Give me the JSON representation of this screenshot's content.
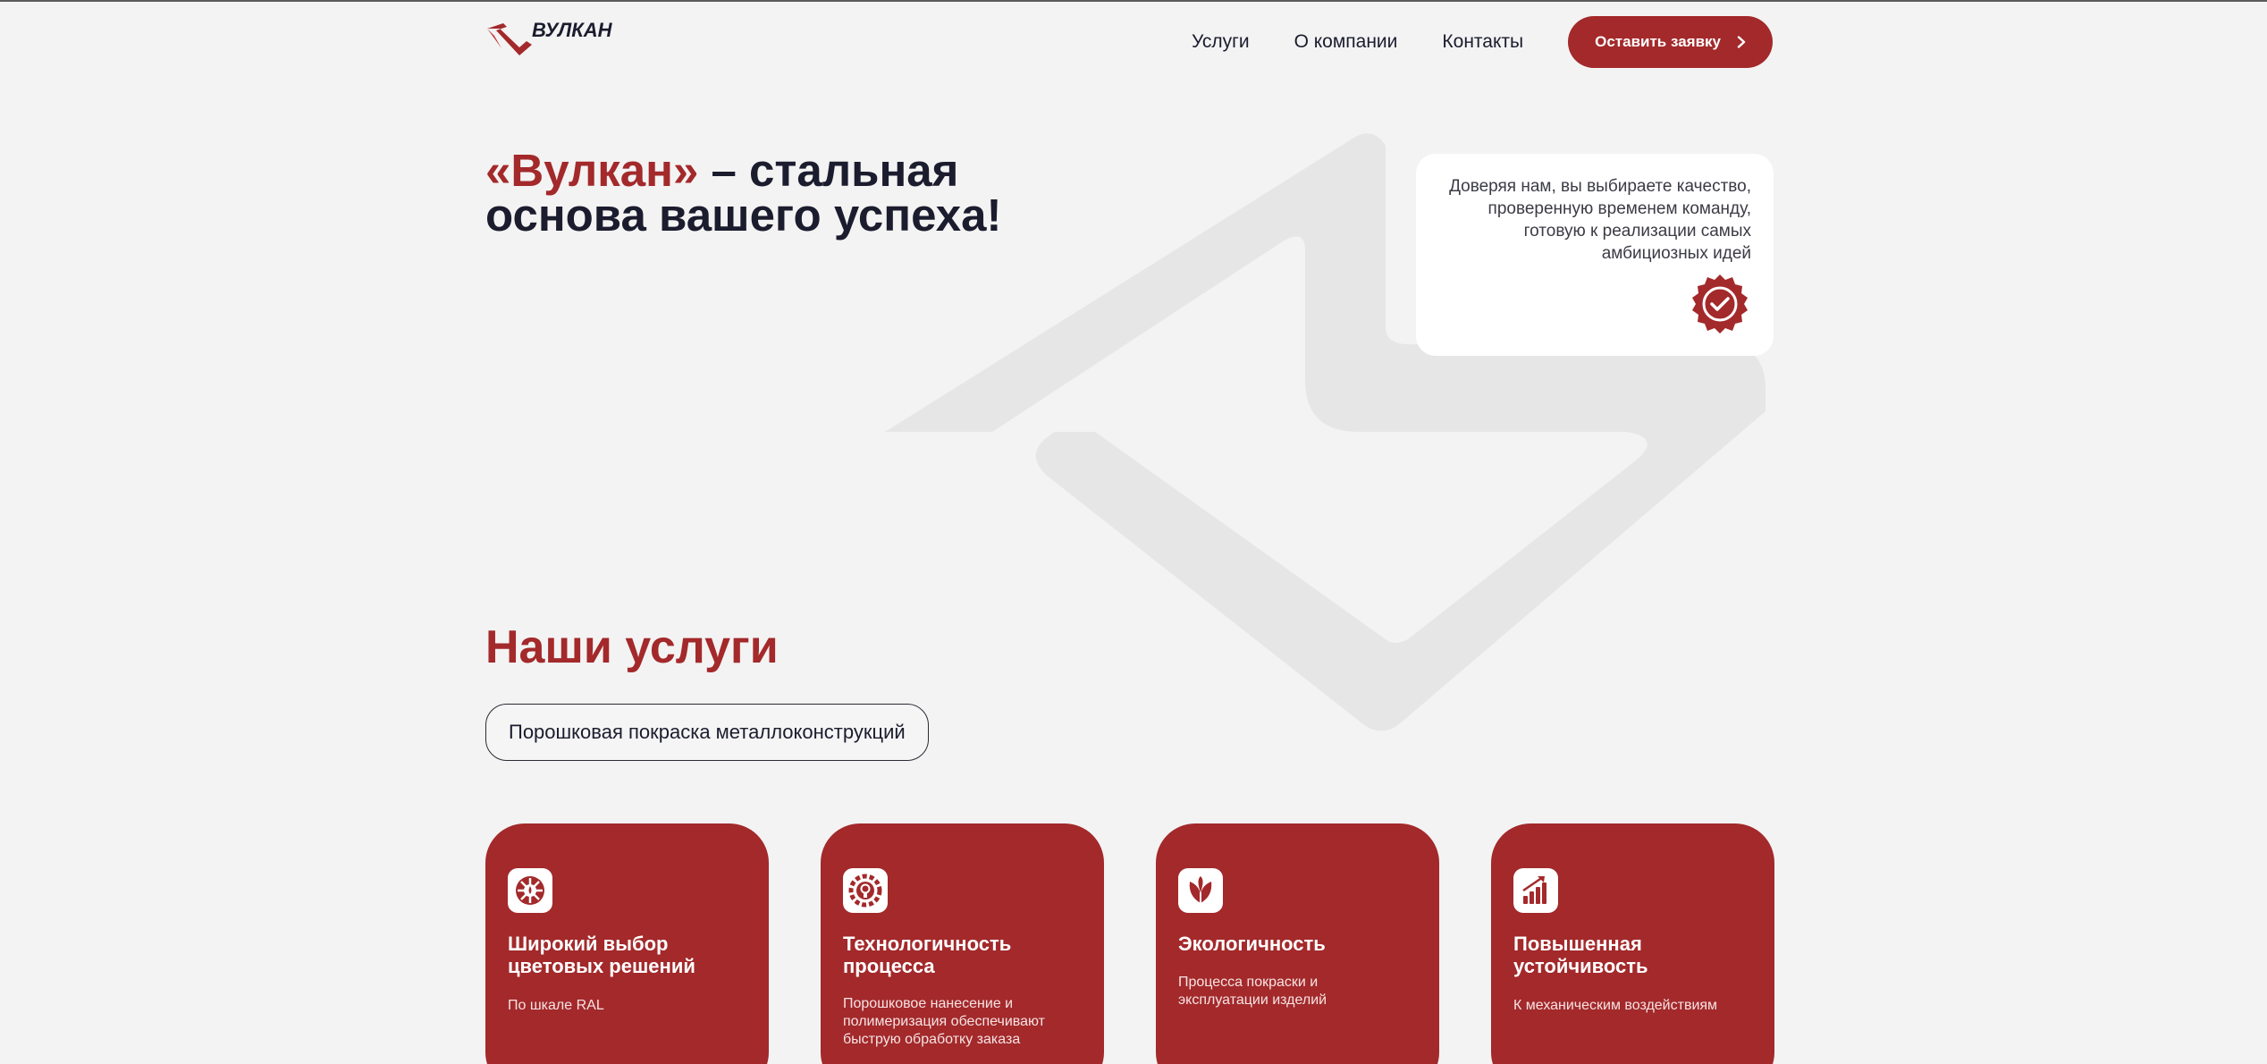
{
  "brand": {
    "name": "ВУЛКАН",
    "accent_color": "#a3292b",
    "text_color": "#1b1c2e"
  },
  "nav": {
    "links": [
      "Услуги",
      "О компании",
      "Контакты"
    ],
    "cta_label": "Оставить заявку"
  },
  "hero": {
    "title_accent": "«Вулкан»",
    "title_rest": " – стальная основа вашего успеха!"
  },
  "trust": {
    "text": "Доверяя нам, вы выбираете качество, проверенную временем команду, готовую к реализации самых амбициозных идей",
    "badge_icon": "check-badge-icon"
  },
  "services": {
    "heading": "Наши услуги",
    "pill_label": "Порошковая покраска металлоконструкций",
    "cards": [
      {
        "icon": "palette-icon",
        "title": "Широкий выбор цветовых решений",
        "subtitle": "По шкале RAL"
      },
      {
        "icon": "gear-lightbulb-icon",
        "title": "Технологичность процесса",
        "subtitle": "Порошковое нанесение и полимеризация обеспечивают быструю обработку заказа"
      },
      {
        "icon": "leaf-icon",
        "title": "Экологичность",
        "subtitle": "Процесса покраски и эксплуатации изделий"
      },
      {
        "icon": "growth-chart-icon",
        "title": "Повышенная устойчивость",
        "subtitle": "К механическим воздействиям"
      }
    ]
  }
}
